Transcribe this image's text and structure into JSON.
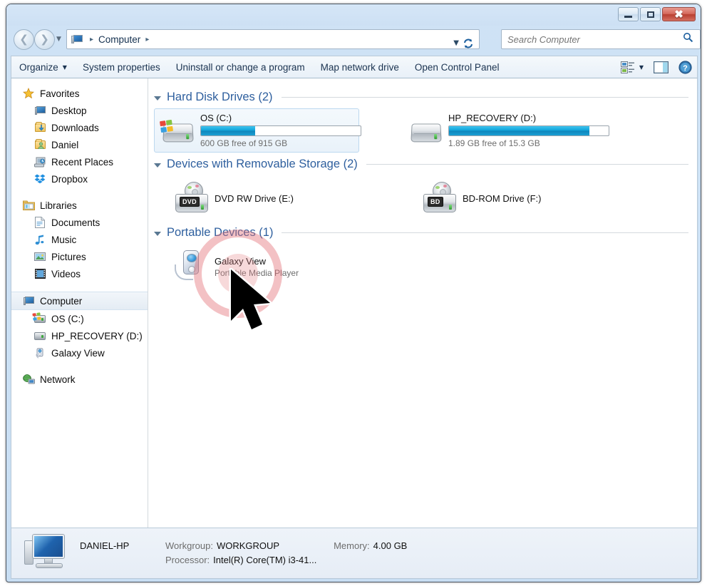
{
  "window": {
    "minimize_label": "Minimize",
    "maximize_label": "Restore",
    "close_label": "Close"
  },
  "addressbar": {
    "back_label": "Back",
    "forward_label": "Forward",
    "history_label": "Recent pages",
    "crumb_root": "Computer",
    "separator": "▸",
    "dropdown": "▼",
    "refresh_label": "Refresh"
  },
  "search": {
    "value": "",
    "placeholder": "Search Computer"
  },
  "toolbar": {
    "organize": "Organize",
    "organize_caret": "▼",
    "system_properties": "System properties",
    "uninstall": "Uninstall or change a program",
    "map_network": "Map network drive",
    "open_control_panel": "Open Control Panel",
    "views_caret": "▼"
  },
  "sidebar": {
    "groups": [
      {
        "header": "Favorites",
        "items": [
          "Desktop",
          "Downloads",
          "Daniel",
          "Recent Places",
          "Dropbox"
        ]
      },
      {
        "header": "Libraries",
        "items": [
          "Documents",
          "Music",
          "Pictures",
          "Videos"
        ]
      },
      {
        "header": "Computer",
        "items": [
          "OS (C:)",
          "HP_RECOVERY (D:)",
          "Galaxy View"
        ]
      },
      {
        "header": "Network",
        "items": []
      }
    ]
  },
  "content": {
    "sections": [
      {
        "title": "Hard Disk Drives (2)",
        "items": [
          {
            "name": "OS (C:)",
            "free_text": "600 GB free of 915 GB",
            "used_percent": 34,
            "highlighted": true
          },
          {
            "name": "HP_RECOVERY (D:)",
            "free_text": "1.89 GB free of 15.3 GB",
            "used_percent": 88,
            "highlighted": false
          }
        ]
      },
      {
        "title": "Devices with Removable Storage (2)",
        "items": [
          {
            "name": "DVD RW Drive (E:)",
            "tag": "DVD"
          },
          {
            "name": "BD-ROM Drive (F:)",
            "tag": "BD"
          }
        ]
      },
      {
        "title": "Portable Devices (1)",
        "items": [
          {
            "name": "Galaxy View",
            "sub": "Portable Media Player"
          }
        ]
      }
    ]
  },
  "statusbar": {
    "computer_name": "DANIEL-HP",
    "workgroup_label": "Workgroup:",
    "workgroup_value": "WORKGROUP",
    "memory_label": "Memory:",
    "memory_value": "4.00 GB",
    "processor_label": "Processor:",
    "processor_value": "Intel(R) Core(TM) i3-41..."
  },
  "colors": {
    "accent_blue": "#2e5f9e",
    "usage_bar": "#14a8dd",
    "close_red": "#b83f31",
    "click_indicator": "#e26c72"
  }
}
